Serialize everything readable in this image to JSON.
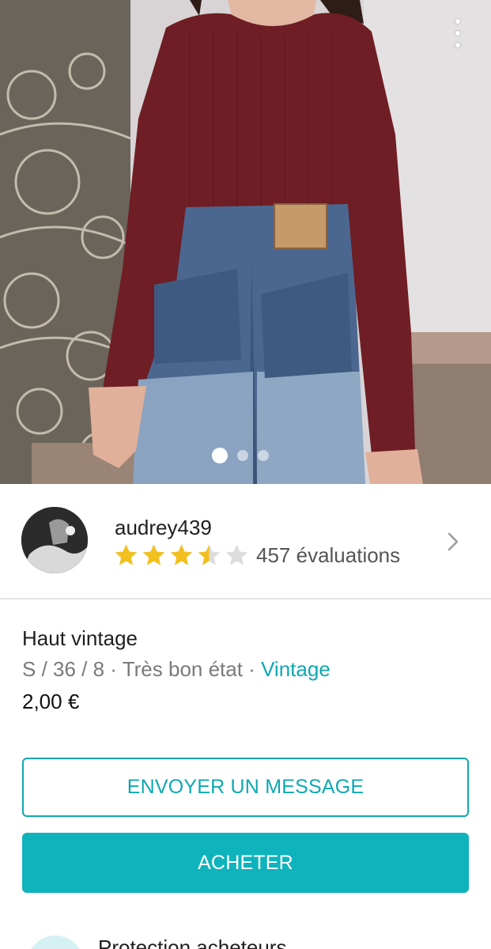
{
  "listing": {
    "photo_count": 3,
    "active_photo": 1
  },
  "seller": {
    "username": "audrey439",
    "rating": 3.5,
    "rating_max": 5,
    "reviews_label": "457 évaluations"
  },
  "item": {
    "title": "Haut vintage",
    "size": "S / 36 / 8",
    "separator": " · ",
    "condition": "Très bon état",
    "brand": "Vintage",
    "price": "2,00 €"
  },
  "actions": {
    "message_label": "ENVOYER UN MESSAGE",
    "buy_label": "ACHETER"
  },
  "protection": {
    "label": "Protection acheteurs"
  },
  "colors": {
    "accent": "#0fa8b1",
    "button_fill": "#0fb3bc",
    "star_filled": "#f2c01f",
    "star_empty": "#dcdcdc"
  },
  "icons": {
    "more": "more-vertical-icon",
    "chevron": "chevron-right-icon",
    "star": "star-icon"
  }
}
